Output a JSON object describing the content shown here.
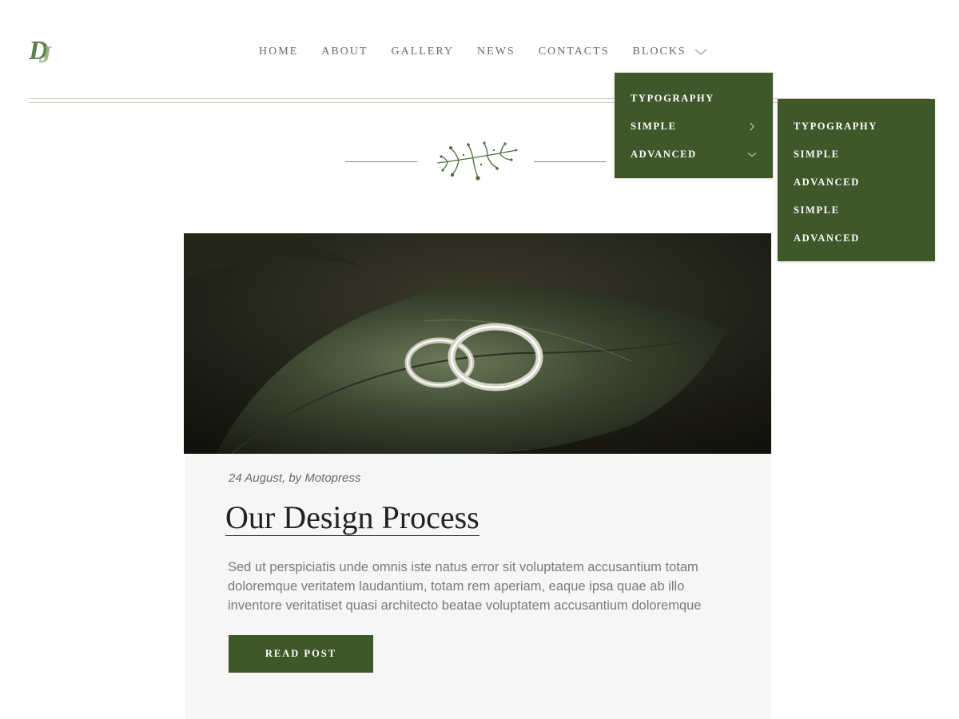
{
  "brand": {
    "logo_icon": "dj-monogram-logo",
    "accent": "#3f582a",
    "logo_color": "#7da36a"
  },
  "nav": {
    "items": [
      {
        "label": "HOME"
      },
      {
        "label": "ABOUT"
      },
      {
        "label": "GALLERY"
      },
      {
        "label": "NEWS"
      },
      {
        "label": "CONTACTS"
      },
      {
        "label": "BLOCKS",
        "icon": "chevron-down-icon"
      }
    ]
  },
  "dropdown": {
    "items": [
      {
        "label": "TYPOGRAPHY"
      },
      {
        "label": "SIMPLE",
        "icon": "chevron-right-icon"
      },
      {
        "label": "ADVANCED",
        "icon": "chevron-down-icon"
      }
    ]
  },
  "submenu": {
    "items": [
      {
        "label": "TYPOGRAPHY"
      },
      {
        "label": "SIMPLE"
      },
      {
        "label": "ADVANCED"
      },
      {
        "label": "SIMPLE"
      },
      {
        "label": "ADVANCED"
      }
    ]
  },
  "divider": {
    "icon": "floral-sprig-icon"
  },
  "post": {
    "image_icon": "wedding-rings-photo",
    "meta": "24 August, by Motopress",
    "title": "Our Design Process",
    "excerpt": "Sed ut perspiciatis unde omnis iste natus error sit voluptatem accusantium totam doloremque veritatem laudantium, totam rem aperiam, eaque ipsa quae ab illo inventore veritatiset quasi architecto beatae voluptatem accusantium doloremque",
    "button_label": "READ POST"
  }
}
